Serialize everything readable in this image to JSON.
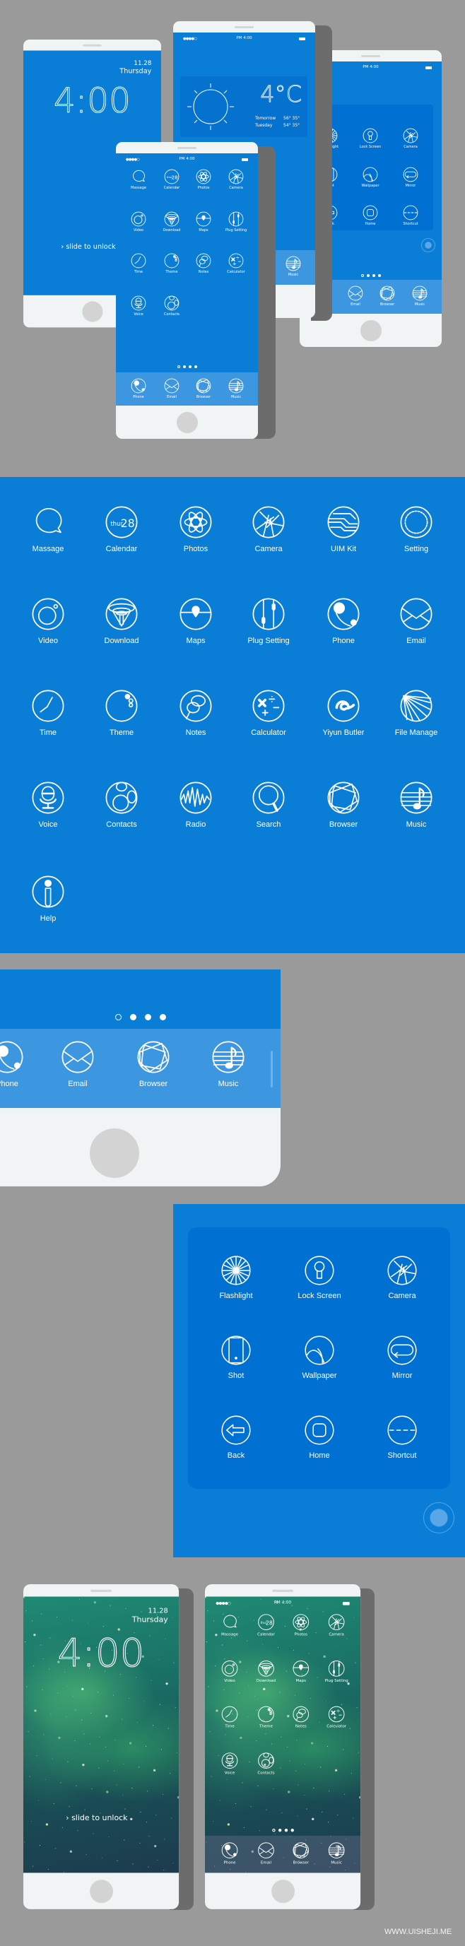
{
  "colors": {
    "background": "#9a9a9a",
    "screen_blue": "#0a7dd6",
    "dock_blue": "#3d97e0",
    "panel_blue": "#0070d2",
    "bezel": "#f1f4f4",
    "home_button": "#d3d3d3",
    "icon_stroke": "#ffffff"
  },
  "status_bar": {
    "signal": "●●●●○",
    "time": "PM 4:00"
  },
  "lock_screen": {
    "date": "11.28",
    "day": "Thursday",
    "time": "4:00",
    "slide_label": "slide to unlock"
  },
  "weather": {
    "temperature": "4°C",
    "forecast": [
      {
        "day": "Tomorrow",
        "temps": "56° 35°"
      },
      {
        "day": "Tuesday",
        "temps": "54° 35°"
      }
    ]
  },
  "calendar_icon": {
    "weekday": "thur",
    "day": "28"
  },
  "home_apps": [
    {
      "label": "Massage",
      "icon": "message"
    },
    {
      "label": "Calendar",
      "icon": "calendar"
    },
    {
      "label": "Photos",
      "icon": "photos"
    },
    {
      "label": "Camera",
      "icon": "camera"
    },
    {
      "label": "Video",
      "icon": "video"
    },
    {
      "label": "Download",
      "icon": "download"
    },
    {
      "label": "Maps",
      "icon": "maps"
    },
    {
      "label": "Plug Setting",
      "icon": "plug"
    },
    {
      "label": "Time",
      "icon": "time"
    },
    {
      "label": "Theme",
      "icon": "theme"
    },
    {
      "label": "Notes",
      "icon": "notes"
    },
    {
      "label": "Calculator",
      "icon": "calculator"
    },
    {
      "label": "Voice",
      "icon": "voice"
    },
    {
      "label": "Contacts",
      "icon": "contacts"
    }
  ],
  "dock": [
    {
      "label": "Phone",
      "icon": "phone"
    },
    {
      "label": "Email",
      "icon": "email"
    },
    {
      "label": "Browser",
      "icon": "browser"
    },
    {
      "label": "Music",
      "icon": "music"
    }
  ],
  "page_dots": {
    "count": 4,
    "active_hollow_index": 0
  },
  "icon_set": [
    {
      "label": "Massage",
      "icon": "message"
    },
    {
      "label": "Calendar",
      "icon": "calendar"
    },
    {
      "label": "Photos",
      "icon": "photos"
    },
    {
      "label": "Camera",
      "icon": "camera"
    },
    {
      "label": "UIM Kit",
      "icon": "uimkit"
    },
    {
      "label": "Setting",
      "icon": "setting"
    },
    {
      "label": "Video",
      "icon": "video"
    },
    {
      "label": "Download",
      "icon": "download"
    },
    {
      "label": "Maps",
      "icon": "maps"
    },
    {
      "label": "Plug Setting",
      "icon": "plug"
    },
    {
      "label": "Phone",
      "icon": "phone"
    },
    {
      "label": "Email",
      "icon": "email"
    },
    {
      "label": "Time",
      "icon": "time"
    },
    {
      "label": "Theme",
      "icon": "theme"
    },
    {
      "label": "Notes",
      "icon": "notes"
    },
    {
      "label": "Calculator",
      "icon": "calculator"
    },
    {
      "label": "Yiyun Butler",
      "icon": "butler"
    },
    {
      "label": "File Manage",
      "icon": "files"
    },
    {
      "label": "Voice",
      "icon": "voice"
    },
    {
      "label": "Contacts",
      "icon": "contacts"
    },
    {
      "label": "Radio",
      "icon": "radio"
    },
    {
      "label": "Search",
      "icon": "search"
    },
    {
      "label": "Browser",
      "icon": "browser"
    },
    {
      "label": "Music",
      "icon": "music"
    },
    {
      "label": "Help",
      "icon": "help"
    }
  ],
  "zoom_dock": [
    {
      "label": "Phone",
      "icon": "phone"
    },
    {
      "label": "Email",
      "icon": "email"
    },
    {
      "label": "Browser",
      "icon": "browser"
    },
    {
      "label": "Music",
      "icon": "music"
    }
  ],
  "control_center": [
    {
      "label": "Flashlight",
      "icon": "flashlight"
    },
    {
      "label": "Lock Screen",
      "icon": "lock"
    },
    {
      "label": "Camera",
      "icon": "camera"
    },
    {
      "label": "Shot",
      "icon": "shot"
    },
    {
      "label": "Wallpaper",
      "icon": "wallpaper"
    },
    {
      "label": "Mirror",
      "icon": "mirror"
    },
    {
      "label": "Back",
      "icon": "back"
    },
    {
      "label": "Home",
      "icon": "home"
    },
    {
      "label": "Shortcut",
      "icon": "shortcut"
    }
  ],
  "watermark": "WWW.UISHEJI.ME"
}
